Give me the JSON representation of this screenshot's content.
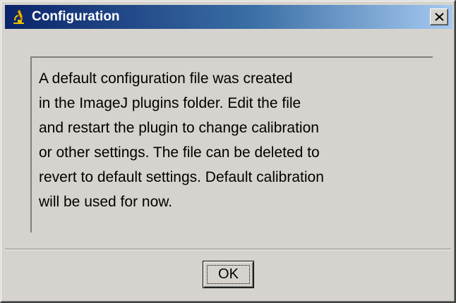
{
  "window": {
    "title": "Configuration",
    "icon": "imagej-microscope-icon",
    "close_icon": "close-x-icon"
  },
  "message": {
    "lines": [
      "A default configuration file was created",
      "in the ImageJ plugins folder. Edit the file",
      "and restart the plugin to change calibration",
      "or other settings. The file can be deleted to",
      "revert to default settings. Default calibration",
      "will be used for now."
    ]
  },
  "buttons": {
    "ok_label": "OK"
  },
  "colors": {
    "titlebar_start": "#0a246a",
    "titlebar_end": "#a6caf0",
    "dialog_face": "#d6d3ce",
    "title_text": "#ffffff"
  }
}
